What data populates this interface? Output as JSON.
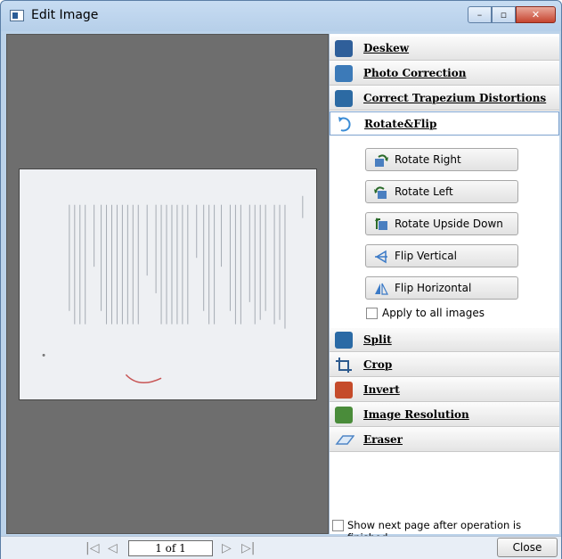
{
  "window": {
    "title": "Edit Image",
    "buttons": {
      "minimize": "–",
      "maximize": "▫",
      "close": "✕"
    }
  },
  "sections": [
    {
      "label": "Deskew",
      "icon": "deskew-icon",
      "color": "#2f5f9a"
    },
    {
      "label": "Photo Correction",
      "icon": "photo-correction-icon",
      "color": "#3c7ab8"
    },
    {
      "label": "Correct Trapezium Distortions",
      "icon": "trapezium-icon",
      "color": "#2c6aa3"
    },
    {
      "label": "Rotate&Flip",
      "icon": "rotate-flip-icon",
      "color": "#3b8cd6",
      "active": true
    }
  ],
  "rotate_actions": [
    {
      "label": "Rotate Right",
      "icon": "rotate-right-icon"
    },
    {
      "label": "Rotate Left",
      "icon": "rotate-left-icon"
    },
    {
      "label": "Rotate Upside Down",
      "icon": "rotate-upside-down-icon"
    },
    {
      "label": "Flip Vertical",
      "icon": "flip-vertical-icon"
    },
    {
      "label": "Flip Horizontal",
      "icon": "flip-horizontal-icon"
    }
  ],
  "apply_all": {
    "label": "Apply to all images",
    "checked": false
  },
  "sections_after": [
    {
      "label": "Split",
      "icon": "split-icon",
      "color": "#2a6aa5"
    },
    {
      "label": "Crop",
      "icon": "crop-icon",
      "color": "#2d5a8e"
    },
    {
      "label": "Invert",
      "icon": "invert-icon",
      "color": "#c54b2a"
    },
    {
      "label": "Image Resolution",
      "icon": "image-resolution-icon",
      "color": "#4a8c3a"
    },
    {
      "label": "Eraser",
      "icon": "eraser-icon",
      "color": "#4f86c6"
    }
  ],
  "show_next_page": {
    "label": "Show next page after operation is finished",
    "checked": false
  },
  "pager": {
    "page_text": "1 of 1"
  },
  "close_label": "Close"
}
